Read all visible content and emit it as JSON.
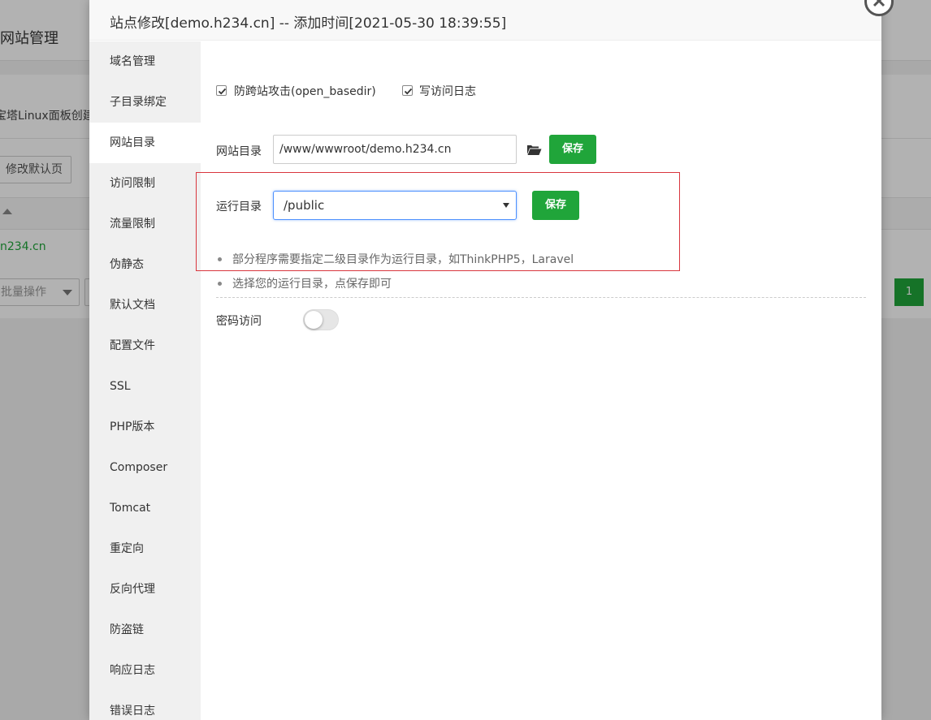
{
  "background": {
    "page_title": "网站管理",
    "notice": "宝塔Linux面板创建站点",
    "default_page_button": "修改默认页",
    "site_domain_partial": "n234.cn",
    "batch_select": "批量操作",
    "pagination_current": "1"
  },
  "dialog": {
    "title": "站点修改[demo.h234.cn] -- 添加时间[2021-05-30 18:39:55]",
    "close_icon": "close-x-icon"
  },
  "sidebar": {
    "items": [
      {
        "label": "域名管理"
      },
      {
        "label": "子目录绑定"
      },
      {
        "label": "网站目录",
        "active": true
      },
      {
        "label": "访问限制"
      },
      {
        "label": "流量限制"
      },
      {
        "label": "伪静态"
      },
      {
        "label": "默认文档"
      },
      {
        "label": "配置文件"
      },
      {
        "label": "SSL"
      },
      {
        "label": "PHP版本"
      },
      {
        "label": "Composer"
      },
      {
        "label": "Tomcat"
      },
      {
        "label": "重定向"
      },
      {
        "label": "反向代理"
      },
      {
        "label": "防盗链"
      },
      {
        "label": "响应日志"
      },
      {
        "label": "错误日志"
      }
    ]
  },
  "content": {
    "anti_xss": {
      "label": "防跨站攻击(open_basedir)",
      "checked": true
    },
    "access_log": {
      "label": "写访问日志",
      "checked": true
    },
    "site_dir": {
      "label": "网站目录",
      "value": "/www/wwwroot/demo.h234.cn",
      "icon": "folder-open-icon",
      "save_label": "保存"
    },
    "run_dir": {
      "label": "运行目录",
      "selected": "/public",
      "save_label": "保存"
    },
    "notes": [
      "部分程序需要指定二级目录作为运行目录，如ThinkPHP5，Laravel",
      "选择您的运行目录，点保存即可"
    ],
    "password_access": {
      "label": "密码访问",
      "enabled": false
    }
  },
  "colors": {
    "accent_green": "#20a53a",
    "highlight_red": "#d9363e",
    "focus_blue": "#4d90fe"
  }
}
